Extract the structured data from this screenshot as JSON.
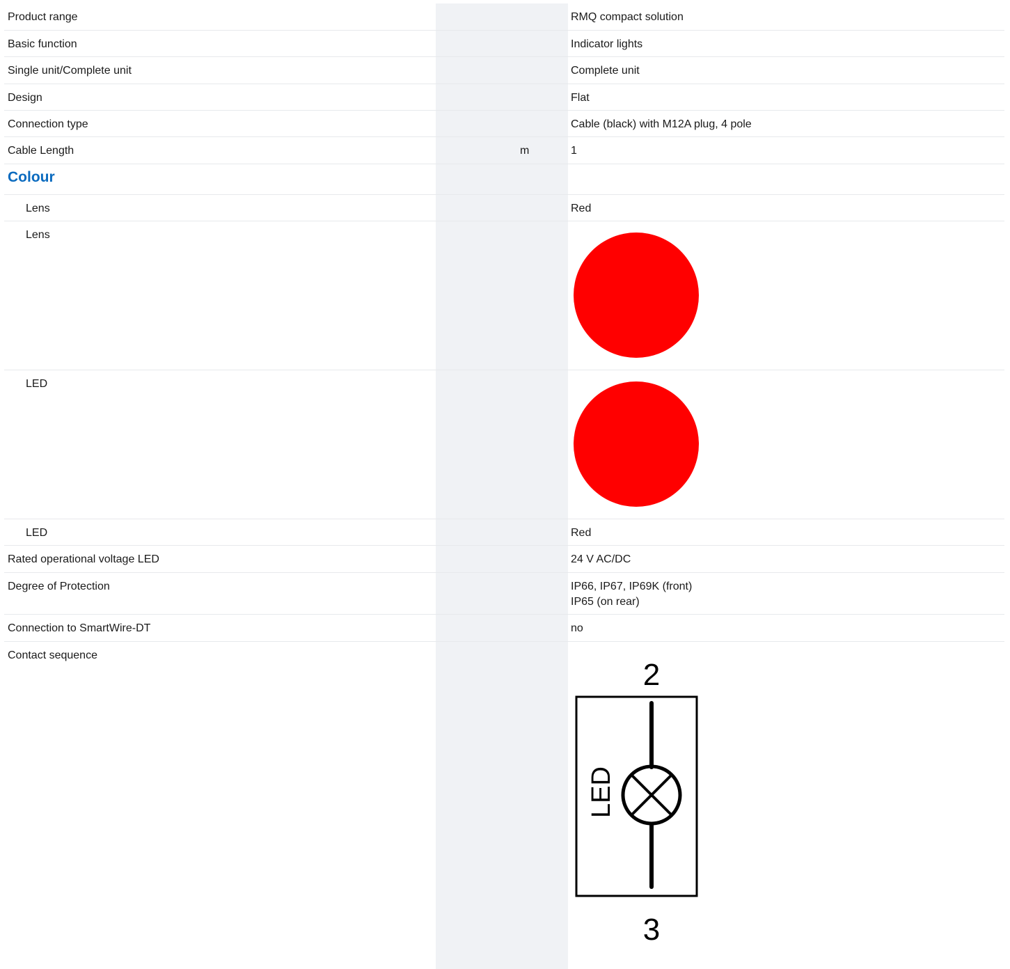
{
  "rows": [
    {
      "label": "Product range",
      "unit": "",
      "value": "RMQ compact solution"
    },
    {
      "label": "Basic function",
      "unit": "",
      "value": "Indicator lights"
    },
    {
      "label": "Single unit/Complete unit",
      "unit": "",
      "value": "Complete unit"
    },
    {
      "label": "Design",
      "unit": "",
      "value": "Flat"
    },
    {
      "label": "Connection type",
      "unit": "",
      "value": "Cable (black) with M12A plug, 4 pole"
    },
    {
      "label": "Cable Length",
      "unit": "m",
      "value": "1"
    },
    {
      "section": "Colour"
    },
    {
      "label": "Lens",
      "unit": "",
      "value": "Red"
    },
    {
      "label": "Lens",
      "swatch": "#ff0000"
    },
    {
      "label": "LED",
      "swatch": "#ff0000"
    },
    {
      "label": "LED",
      "unit": "",
      "value": "Red"
    },
    {
      "label": "Rated operational voltage LED",
      "unit": "",
      "value": "24 V AC/DC"
    },
    {
      "label": "Degree of Protection",
      "unit": "",
      "value": "IP66, IP67, IP69K (front)\nIP65 (on rear)"
    },
    {
      "label": "Connection to SmartWire-DT",
      "unit": "",
      "value": "no"
    },
    {
      "label": "Contact sequence",
      "diagram": {
        "top_terminal": "2",
        "bottom_terminal": "3",
        "device_label": "LED",
        "symbol": "indicator-lamp-icon"
      }
    }
  ],
  "colors": {
    "section_heading": "#0b6bbf",
    "unit_band": "#f0f2f5",
    "swatch_red": "#ff0000"
  }
}
